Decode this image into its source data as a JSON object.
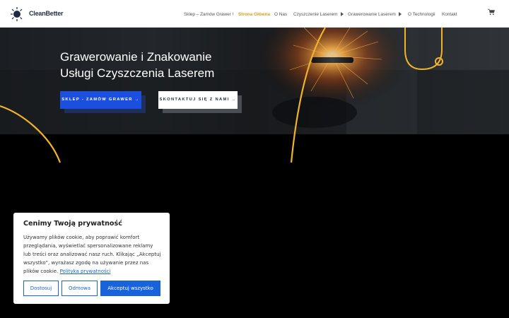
{
  "header": {
    "logo_text": "CleanBetter",
    "nav": [
      {
        "label": "Sklep – Zamów Grawer !",
        "has_caret": false,
        "active": false
      },
      {
        "label": "Strona Główna",
        "has_caret": false,
        "active": true
      },
      {
        "label": "O Nas",
        "has_caret": false,
        "active": false
      },
      {
        "label": "Czyszczenie Laserem",
        "has_caret": true,
        "active": false
      },
      {
        "label": "Grawerowanie Laserem",
        "has_caret": true,
        "active": false
      },
      {
        "label": "O Technologii",
        "has_caret": false,
        "active": false
      },
      {
        "label": "Kontakt",
        "has_caret": false,
        "active": false
      }
    ],
    "cart_icon": "cart-icon"
  },
  "hero": {
    "title_line1": "Grawerowanie i Znakowanie",
    "title_line2": "Usługi Czyszczenia Laserem",
    "btn_shop": "SKLEP - ZAMÓW GRAWER →",
    "btn_contact": "SKONTAKTUJ SIĘ Z NAMI →"
  },
  "cookie": {
    "title": "Cenimy Twoją prywatność",
    "text": "Używamy plików cookie, aby poprawić komfort przeglądania, wyświetlać spersonalizowane reklamy lub treści oraz analizować nasz ruch. Klikając „Akceptuj wszystko”, wyrażasz zgodę na używanie przez nas plików cookie.",
    "link": "Polityka prywatności",
    "btn_customize": "Dostosuj",
    "btn_reject": "Odmowa",
    "btn_accept": "Akceptuj wszystko"
  },
  "colors": {
    "accent_gold": "#f0b429",
    "primary_blue": "#1a4fe0",
    "cookie_blue": "#1863dc",
    "active_nav": "#d8a01c"
  }
}
